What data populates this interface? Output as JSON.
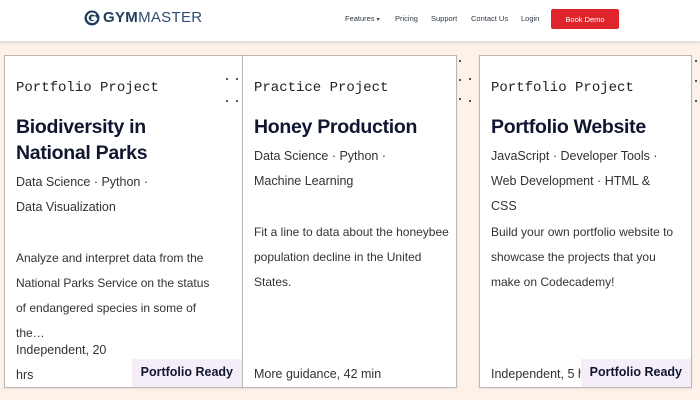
{
  "nav": {
    "logo_gym": "GYM",
    "logo_master": "MASTER",
    "logo_icon": "gymmaster-g-icon",
    "links": [
      "Features",
      "Pricing",
      "Support",
      "Contact Us",
      "Login"
    ],
    "book_demo": "Book Demo",
    "brand_color": "#1f3b5c",
    "button_color": "#e0242b"
  },
  "cards": [
    {
      "eyebrow": "Portfolio Project",
      "title": "Biodiversity in National Parks",
      "tags": "Data Science · Python · Data Visualization",
      "description": "Analyze and interpret data from the National Parks Service on the status of endangered species in some of the…",
      "meta": "Independent, 20 hrs",
      "badge": "Portfolio Ready"
    },
    {
      "eyebrow": "Practice Project",
      "title": "Honey Production",
      "tags": "Data Science · Python · Machine Learning",
      "description": "Fit a line to data about the honeybee population decline in the United States.",
      "meta": "More guidance, 42 min",
      "badge": ""
    },
    {
      "eyebrow": "Portfolio Project",
      "title": "Portfolio Website",
      "tags": "JavaScript · Developer Tools · Web Development · HTML & CSS",
      "description": "Build your own portfolio website to showcase the projects that you make on Codecademy!",
      "meta": "Independent, 5 hrs",
      "badge": "Portfolio Ready"
    }
  ],
  "colors": {
    "page_background": "#fdf1ea",
    "badge_background": "#f5eef9",
    "title_text": "#10162f"
  }
}
